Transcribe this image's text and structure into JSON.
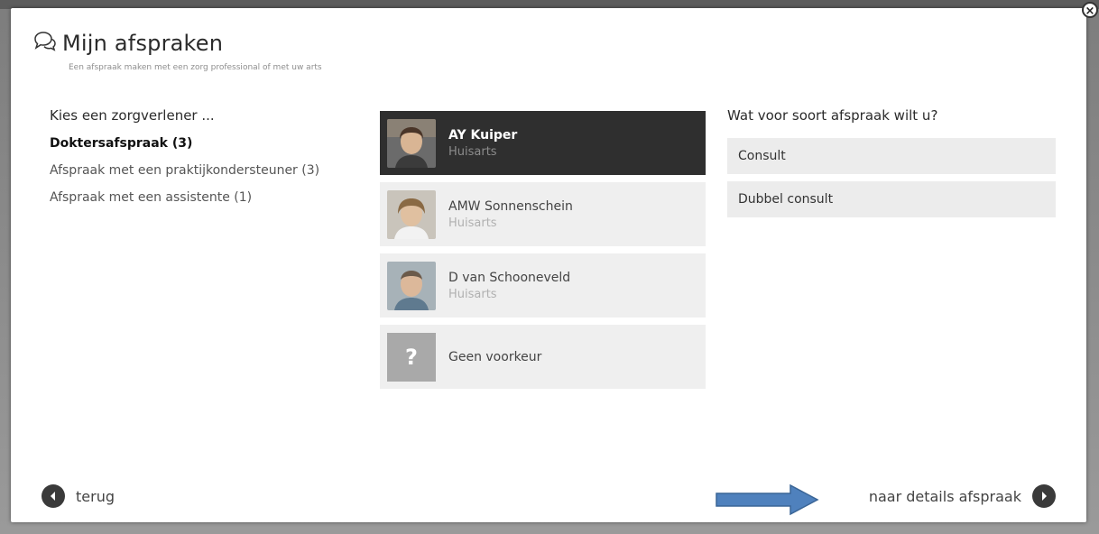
{
  "header": {
    "title": "Mijn afspraken",
    "subtitle": "Een afspraak maken met een zorg professional of met uw arts"
  },
  "close_label": "×",
  "left": {
    "heading": "Kies een zorgverlener ...",
    "categories": [
      {
        "label": "Doktersafspraak (3)",
        "active": true
      },
      {
        "label": "Afspraak met een praktijkondersteuner (3)",
        "active": false
      },
      {
        "label": "Afspraak met een assistente (1)",
        "active": false
      }
    ]
  },
  "providers": [
    {
      "name": "AY Kuiper",
      "role": "Huisarts",
      "selected": true
    },
    {
      "name": "AMW Sonnenschein",
      "role": "Huisarts",
      "selected": false
    },
    {
      "name": "D van Schooneveld",
      "role": "Huisarts",
      "selected": false
    },
    {
      "name": "Geen voorkeur",
      "role": "",
      "placeholder_glyph": "?",
      "selected": false
    }
  ],
  "right": {
    "heading": "Wat voor soort afspraak wilt u?",
    "types": [
      "Consult",
      "Dubbel consult"
    ]
  },
  "nav": {
    "back_label": "terug",
    "next_label": "naar details afspraak"
  },
  "colors": {
    "selected_bg": "#2f2f2f",
    "item_bg": "#efefef",
    "arrow": "#4f81bd"
  },
  "icons": {
    "title_icon": "chat-bubbles-icon",
    "back_icon": "chevron-left-circle-icon",
    "next_icon": "chevron-right-circle-icon",
    "close_icon": "close-icon"
  }
}
